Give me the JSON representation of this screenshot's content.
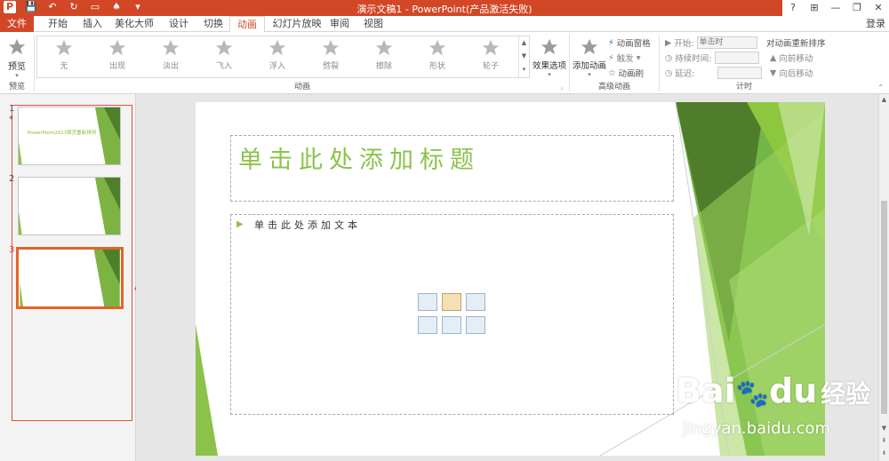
{
  "window": {
    "title": "演示文稿1 -  PowerPoint(产品激活失败)",
    "buttons": [
      "?",
      "⊞",
      "—",
      "❐",
      "✕"
    ]
  },
  "qat": [
    "P",
    "💾",
    "↶",
    "↻",
    "▭",
    "♠",
    "▾"
  ],
  "tabs": {
    "file": "文件",
    "items": [
      "开始",
      "插入",
      "美化大师",
      "设计",
      "切换",
      "动画",
      "幻灯片放映",
      "审阅",
      "视图"
    ],
    "active": "动画",
    "login": "登录"
  },
  "ribbon": {
    "preview": {
      "label": "预览",
      "group": "预览"
    },
    "animations": [
      "无",
      "出现",
      "淡出",
      "飞入",
      "浮入",
      "劈裂",
      "擦除",
      "形状",
      "轮子"
    ],
    "effect_options": "效果选项",
    "group_animation": "动画",
    "add_animation": "添加动画",
    "pane": "动画窗格",
    "trigger": "触发",
    "painter": "动画刷",
    "group_advanced": "高级动画",
    "start_label": "开始:",
    "start_value": "单击时",
    "duration_label": "持续时间:",
    "delay_label": "延迟:",
    "group_timing": "计时",
    "reorder": "对动画重新排序",
    "move_earlier": "向前移动",
    "move_later": "向后移动"
  },
  "slides": [
    {
      "num": "1",
      "star": "*",
      "text": "PowerPoint2013首页重新排列"
    },
    {
      "num": "2"
    },
    {
      "num": "3"
    }
  ],
  "slide": {
    "title_placeholder": "单击此处添加标题",
    "body_placeholder": "单击此处添加文本",
    "bullet": "▶"
  },
  "watermark": {
    "brand": "Bai",
    "brand2": "du",
    "sub": "经验",
    "url": "jingyan.baidu.com"
  },
  "colors": {
    "accent": "#d24726",
    "theme_green": "#8bc34a",
    "arrow_red": "#e53935"
  }
}
